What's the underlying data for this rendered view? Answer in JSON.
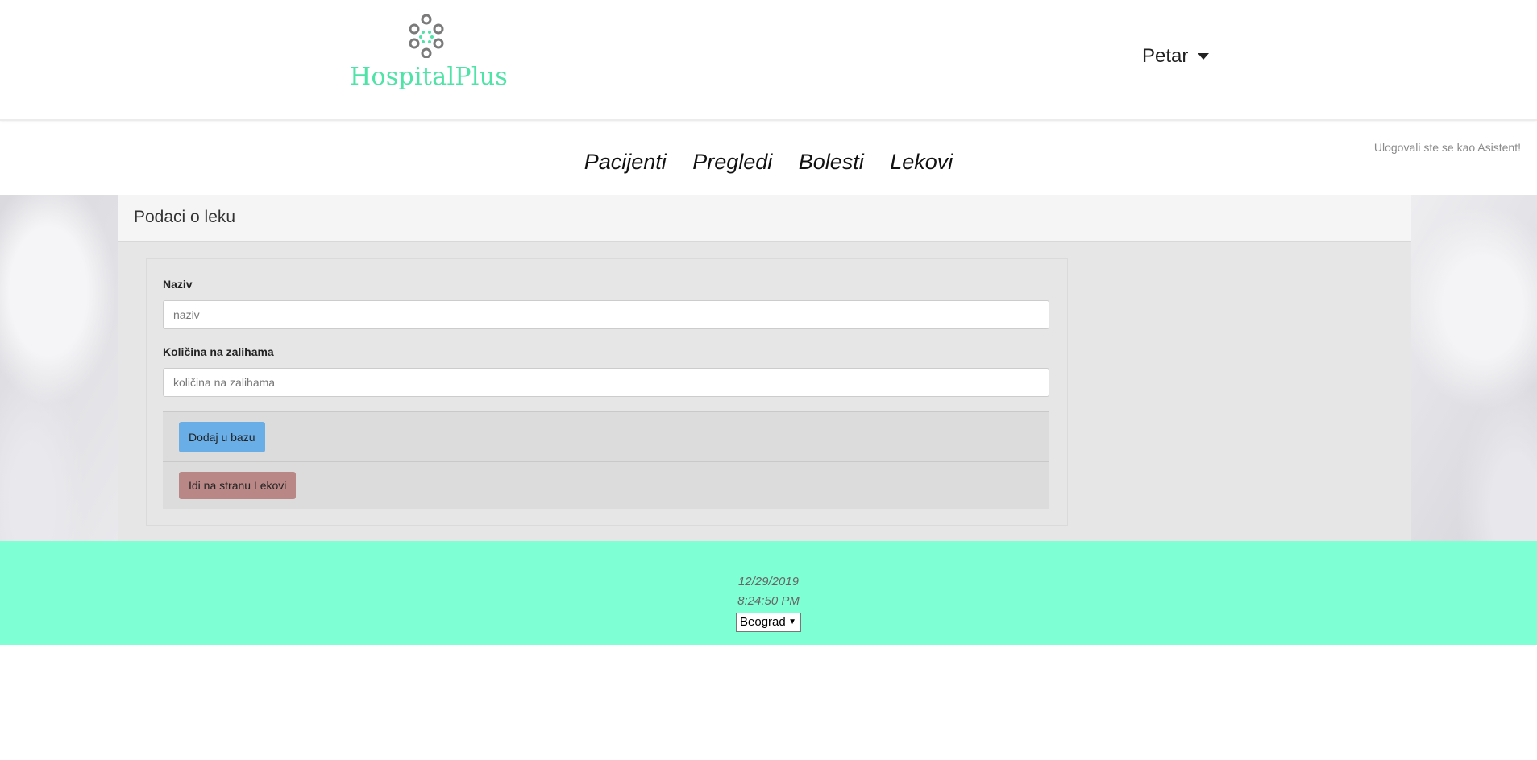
{
  "brand": {
    "name": "HospitalPlus",
    "accent_color": "#4fe3a7",
    "icon": "logo-dots-icon"
  },
  "user_menu": {
    "name": "Petar",
    "icon": "caret-down-icon"
  },
  "session": {
    "logged_as": "Ulogovali ste se kao Asistent!"
  },
  "nav": {
    "items": [
      {
        "label": "Pacijenti"
      },
      {
        "label": "Pregledi"
      },
      {
        "label": "Bolesti"
      },
      {
        "label": "Lekovi"
      }
    ]
  },
  "panel": {
    "title": "Podaci o leku"
  },
  "form": {
    "name_label": "Naziv",
    "name_placeholder": "naziv",
    "stock_label": "Količina na zalihama",
    "stock_placeholder": "količina na zalihama",
    "add_button": "Dodaj u bazu",
    "goto_button": "Idi na stranu Lekovi"
  },
  "footer": {
    "date": "12/29/2019",
    "time": "8:24:50 PM",
    "city_selected": "Beograd",
    "background_color": "#7fffd4"
  }
}
